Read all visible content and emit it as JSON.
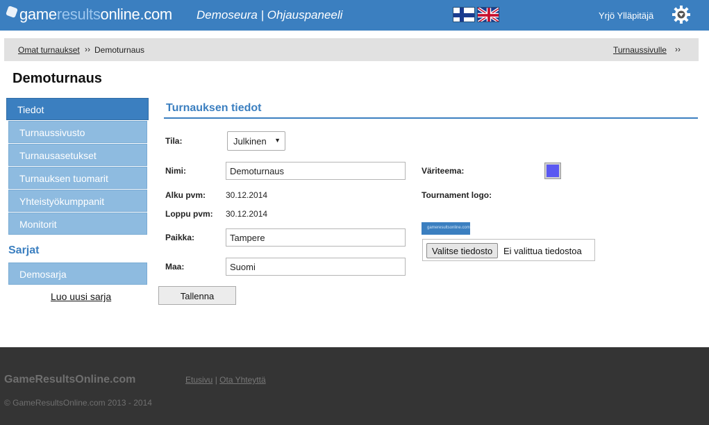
{
  "header": {
    "logo": {
      "part1": "game",
      "part2": "results",
      "part3": "online.com"
    },
    "title": "Demoseura | Ohjauspaneeli",
    "user": "Yrjö Ylläpitäjä",
    "icons": {
      "settings": "gear-icon",
      "lang_fi": "finnish-flag-icon",
      "lang_en": "uk-flag-icon"
    }
  },
  "breadcrumb": {
    "link": "Omat turnaukset",
    "separator": "››",
    "current": "Demoturnaus",
    "right_link": "Turnaussivulle",
    "right_separator": "››"
  },
  "page_title": "Demoturnaus",
  "sidebar": {
    "active": "Tiedot",
    "items": [
      {
        "label": "Turnaussivusto"
      },
      {
        "label": "Turnausasetukset"
      },
      {
        "label": "Turnauksen tuomarit"
      },
      {
        "label": "Yhteistyökumppanit"
      },
      {
        "label": "Monitorit"
      }
    ],
    "section": "Sarjat",
    "series": [
      {
        "label": "Demosarja"
      }
    ],
    "new_series": "Luo uusi sarja"
  },
  "main": {
    "section_title": "Turnauksen tiedot",
    "status_label": "Tila:",
    "status_value": "Julkinen",
    "name_label": "Nimi:",
    "name_value": "Demoturnaus",
    "start_label": "Alku pvm:",
    "start_value": "30.12.2014",
    "end_label": "Loppu pvm:",
    "end_value": "30.12.2014",
    "place_label": "Paikka:",
    "place_value": "Tampere",
    "country_label": "Maa:",
    "country_value": "Suomi",
    "color_label": "Väriteema:",
    "color_value": "#5a58f2",
    "logo_label": "Tournament logo:",
    "logo_image_text": "gameresultsonline.com",
    "file_button": "Valitse tiedosto",
    "file_status": "Ei valittua tiedostoa",
    "save_button": "Tallenna"
  },
  "footer": {
    "brand": "GameResultsOnline.com",
    "link_home": "Etusivu",
    "link_sep": " | ",
    "link_contact": "Ota Yhteyttä",
    "copyright": "© GameResultsOnline.com 2013 - 2014"
  },
  "colors": {
    "primary": "#3b7fc0",
    "sidebar_light": "#8ebbe0",
    "footer": "#343434"
  }
}
